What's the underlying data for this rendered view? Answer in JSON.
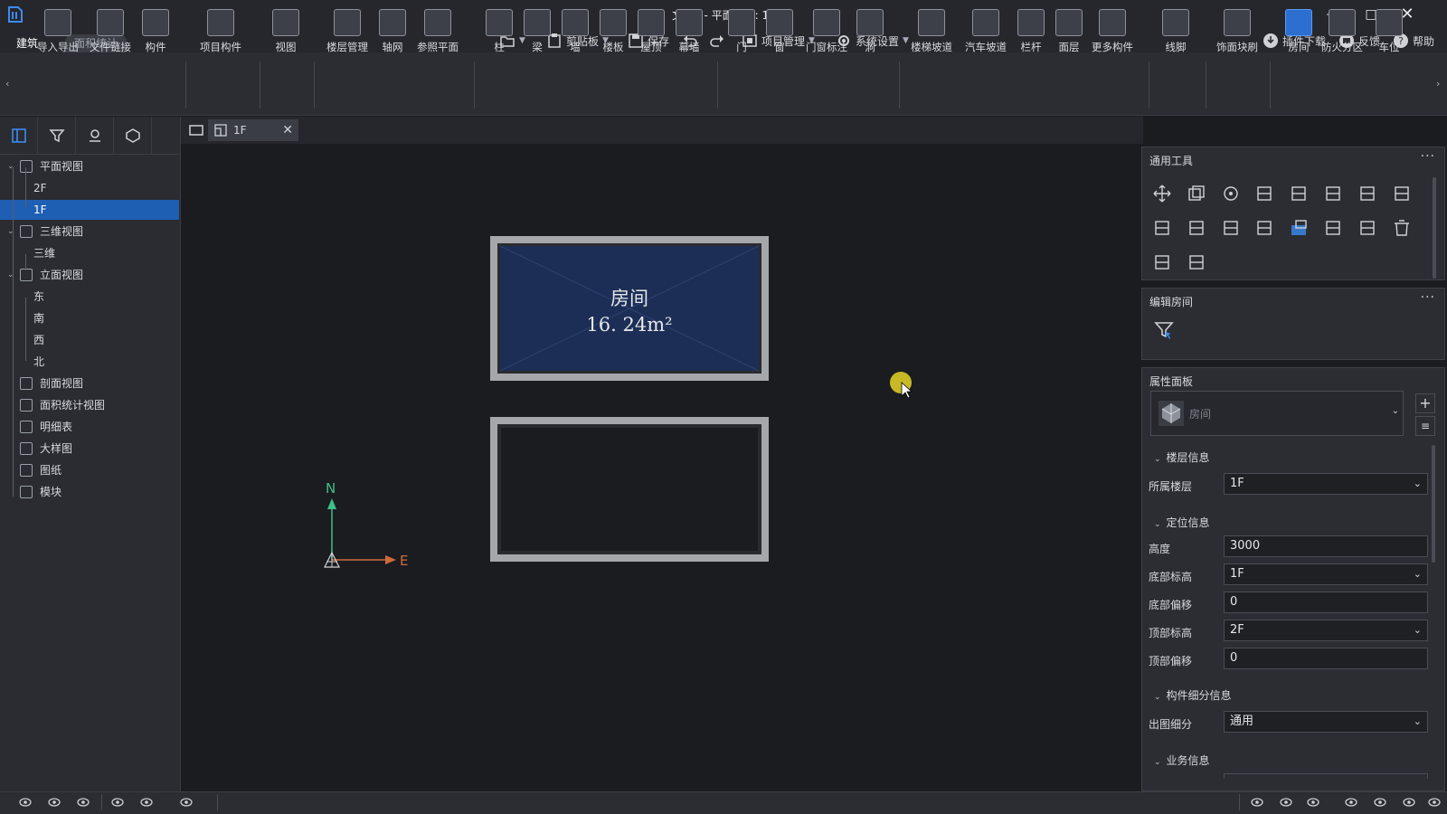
{
  "window": {
    "title": "文件1 - 平面视图: 1F",
    "minimize": "–",
    "maximize": "□",
    "close": "✕"
  },
  "menu_tabs": [
    {
      "label": "建筑"
    },
    {
      "label": "面积统计"
    }
  ],
  "quick_access": {
    "open_icon": "folder-open-icon",
    "clipboard": "剪贴板",
    "save": "保存",
    "undo": "undo-icon",
    "redo": "redo-icon",
    "project": "项目管理",
    "settings": "系统设置"
  },
  "top_right": {
    "plugins": "插件下载",
    "feedback": "反馈",
    "help": "帮助"
  },
  "ribbon": [
    {
      "label": "导入导出"
    },
    {
      "label": "文件链接"
    },
    {
      "label": "构件"
    },
    {
      "label": "项目构件"
    },
    {
      "label": "视图"
    },
    {
      "label": "楼层管理"
    },
    {
      "label": "轴网"
    },
    {
      "label": "参照平面"
    },
    {
      "label": "柱"
    },
    {
      "label": "梁"
    },
    {
      "label": "墙"
    },
    {
      "label": "楼板"
    },
    {
      "label": "屋顶"
    },
    {
      "label": "幕墙"
    },
    {
      "label": "门"
    },
    {
      "label": "窗"
    },
    {
      "label": "门窗标注"
    },
    {
      "label": "洞"
    },
    {
      "label": "楼梯坡道"
    },
    {
      "label": "汽车坡道"
    },
    {
      "label": "栏杆"
    },
    {
      "label": "面层"
    },
    {
      "label": "更多构件"
    },
    {
      "label": "线脚"
    },
    {
      "label": "饰面块刷"
    },
    {
      "label": "房间"
    },
    {
      "label": "防火分区"
    },
    {
      "label": "车位"
    }
  ],
  "tree": [
    {
      "label": "平面视图"
    },
    {
      "label": "2F"
    },
    {
      "label": "1F"
    },
    {
      "label": "三维视图"
    },
    {
      "label": "三维"
    },
    {
      "label": "立面视图"
    },
    {
      "label": "东"
    },
    {
      "label": "南"
    },
    {
      "label": "西"
    },
    {
      "label": "北"
    },
    {
      "label": "剖面视图"
    },
    {
      "label": "面积统计视图"
    },
    {
      "label": "明细表"
    },
    {
      "label": "大样图"
    },
    {
      "label": "图纸"
    },
    {
      "label": "模块"
    }
  ],
  "doc_tab": {
    "label": "1F",
    "close": "✕"
  },
  "canvas": {
    "room_name": "房间",
    "room_area": "16. 24m²",
    "north": "N",
    "east": "E"
  },
  "general_tools": {
    "title": "通用工具",
    "more": "···"
  },
  "edit_room": {
    "title": "编辑房间",
    "more": "···"
  },
  "properties": {
    "title": "属性面板",
    "type_selector": "房间",
    "groups": {
      "floor": "楼层信息",
      "position": "定位信息",
      "detail": "构件细分信息",
      "business": "业务信息"
    },
    "rows": {
      "floor": {
        "label": "所属楼层",
        "value": "1F"
      },
      "height": {
        "label": "高度",
        "value": "3000"
      },
      "base_level": {
        "label": "底部标高",
        "value": "1F"
      },
      "base_offset": {
        "label": "底部偏移",
        "value": "0"
      },
      "top_level": {
        "label": "顶部标高",
        "value": "2F"
      },
      "top_offset": {
        "label": "顶部偏移",
        "value": "0"
      },
      "output_detail": {
        "label": "出图细分",
        "value": "通用"
      }
    }
  },
  "colors": {
    "room_fill": "#1c2e55",
    "selection": "#1e5fb4",
    "north": "#3cc08a",
    "east": "#d06a3a"
  }
}
